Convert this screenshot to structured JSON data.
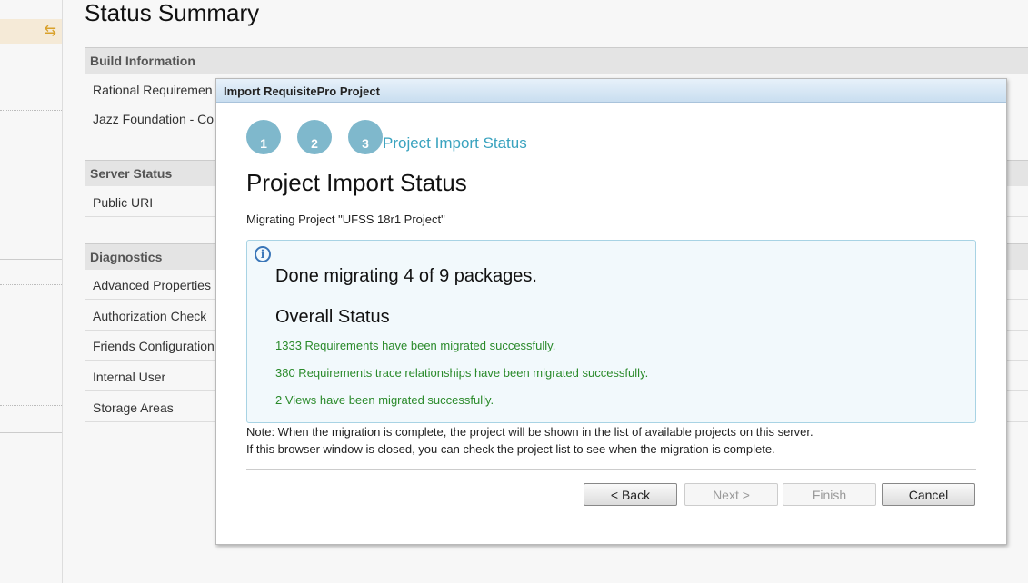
{
  "page": {
    "title": "Status Summary"
  },
  "sidebar": {
    "active_icon": "refresh-icon"
  },
  "sections": [
    {
      "header": "Build Information",
      "rows": [
        "Rational Requiremen",
        "Jazz Foundation - Co"
      ]
    },
    {
      "header": "Server Status",
      "rows": [
        "Public URI"
      ]
    },
    {
      "header": "Diagnostics",
      "rows": [
        "Advanced Properties",
        "Authorization Check",
        "Friends Configuration",
        "Internal User",
        "Storage Areas"
      ]
    }
  ],
  "dialog": {
    "title": "Import RequisitePro Project",
    "steps": [
      "1",
      "2",
      "3"
    ],
    "current_step_label": "Project Import Status",
    "heading": "Project Import Status",
    "migrating": "Migrating Project \"UFSS 18r1 Project\"",
    "done": "Done migrating 4 of 9 packages.",
    "overall_heading": "Overall Status",
    "results": [
      "1333 Requirements have been migrated successfully.",
      "380 Requirements trace relationships have been migrated successfully.",
      "2 Views have been migrated successfully."
    ],
    "note1": "Note: When the migration is complete, the project will be shown in the list of available projects on this server.",
    "note2": "If this browser window is closed, you can check the project list to see when the migration is complete.",
    "buttons": {
      "back": "< Back",
      "next": "Next >",
      "finish": "Finish",
      "cancel": "Cancel"
    }
  }
}
